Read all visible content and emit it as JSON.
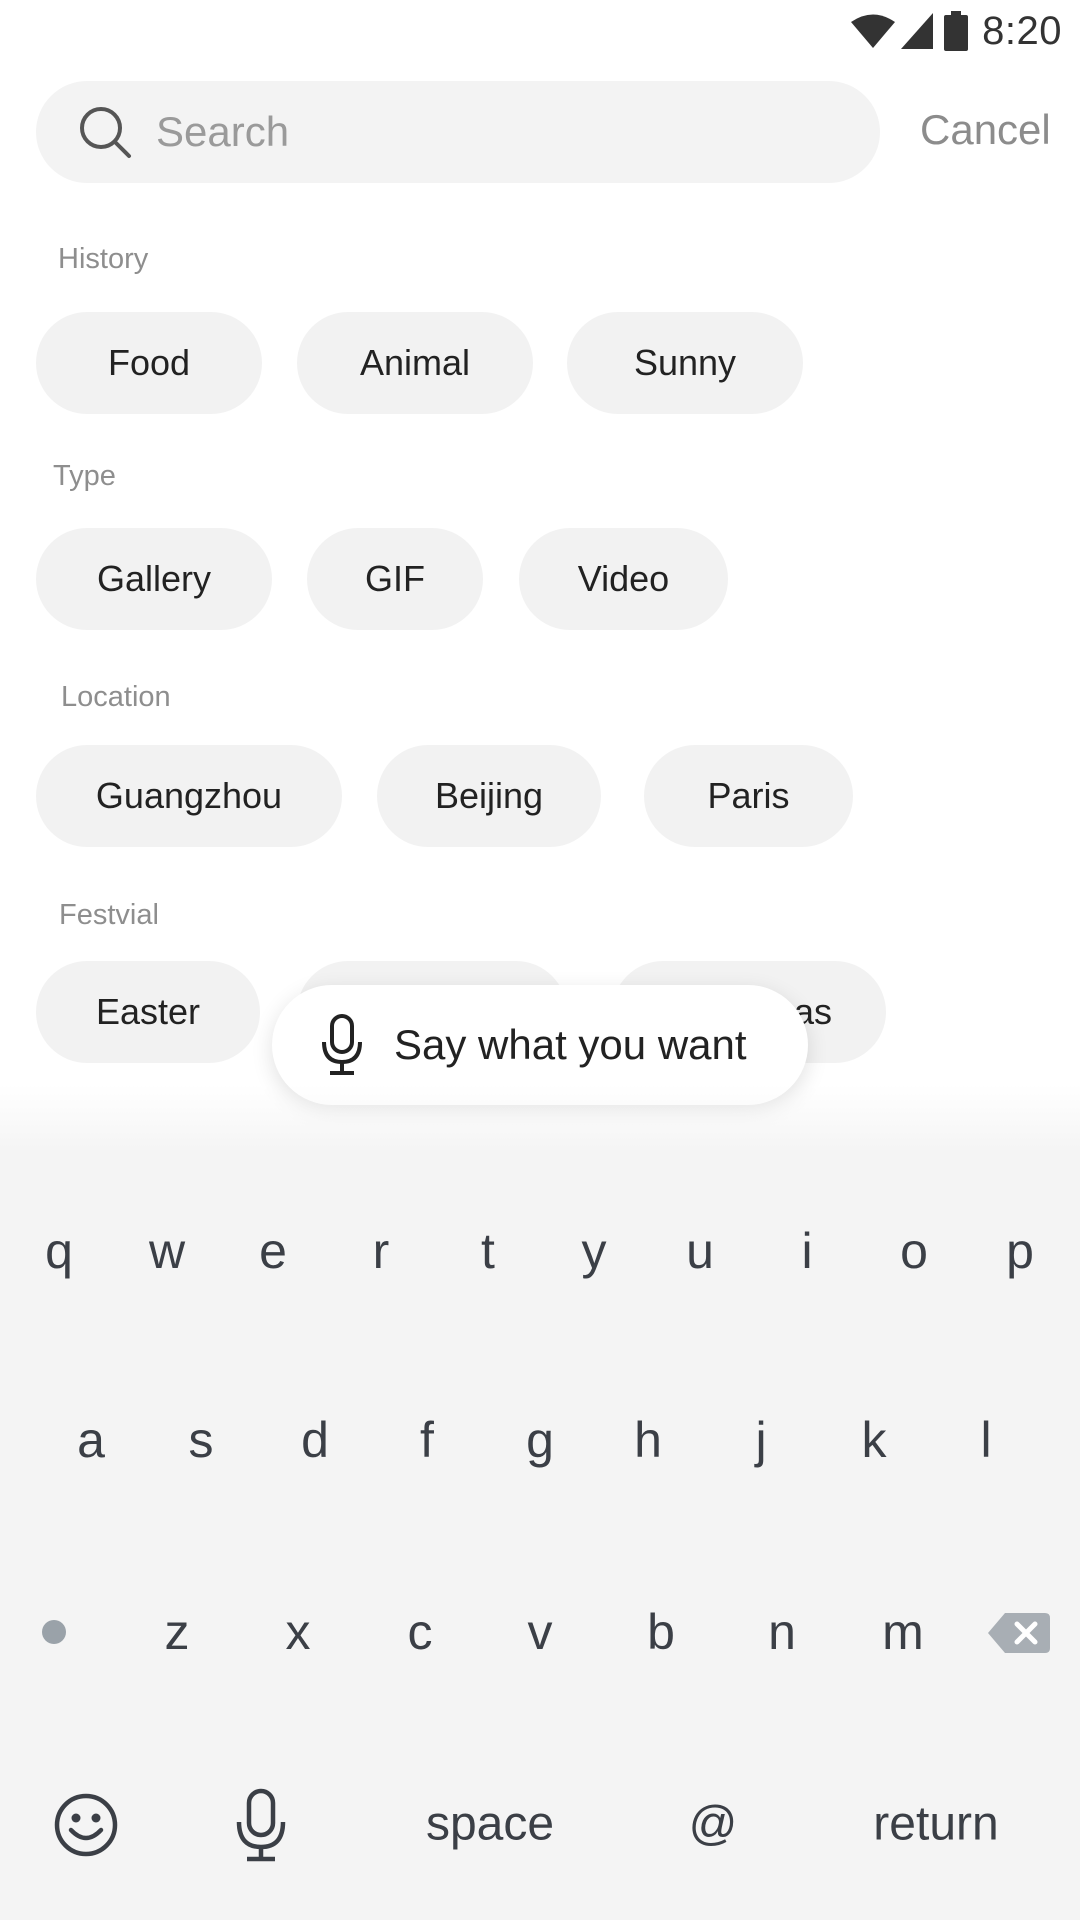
{
  "status_bar": {
    "time": "8:20"
  },
  "search": {
    "placeholder": "Search",
    "value": "",
    "cancel_label": "Cancel"
  },
  "sections": {
    "history": {
      "title": "History",
      "chips": [
        "Food",
        "Animal",
        "Sunny"
      ]
    },
    "type": {
      "title": "Type",
      "chips": [
        "Gallery",
        "GIF",
        "Video"
      ]
    },
    "location": {
      "title": "Location",
      "chips": [
        "Guangzhou",
        "Beijing",
        "Paris"
      ]
    },
    "festival": {
      "title": "Festvial",
      "chips": [
        "Easter",
        "",
        "as"
      ]
    }
  },
  "voice_prompt": {
    "label": "Say what you want"
  },
  "keyboard": {
    "row1": [
      "q",
      "w",
      "e",
      "r",
      "t",
      "y",
      "u",
      "i",
      "o",
      "p"
    ],
    "row2": [
      "a",
      "s",
      "d",
      "f",
      "g",
      "h",
      "j",
      "k",
      "l"
    ],
    "row3": [
      "z",
      "x",
      "c",
      "v",
      "b",
      "n",
      "m"
    ],
    "space_label": "space",
    "at_label": "@",
    "return_label": "return"
  },
  "icons": {
    "search": "search-icon",
    "mic": "microphone-icon",
    "emoji": "emoji-icon",
    "backspace": "backspace-icon",
    "shift": "shift-dot-icon"
  },
  "colors": {
    "chip_bg": "#f2f2f2",
    "keyboard_bg": "#f4f4f4",
    "muted_text": "#8e8e8e"
  }
}
